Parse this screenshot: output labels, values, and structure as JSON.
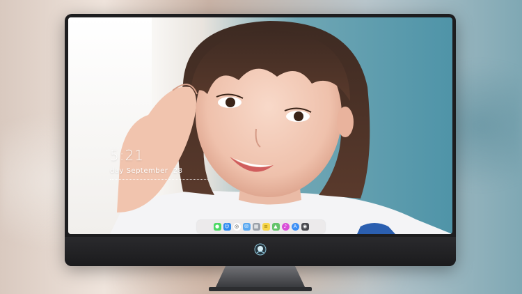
{
  "lockscreen": {
    "time": "5:21",
    "date": "day September  28"
  },
  "dock": {
    "apps": [
      {
        "name": "messages",
        "color": "#4cd964"
      },
      {
        "name": "finder",
        "color": "#2f8bf0"
      },
      {
        "name": "safari",
        "color": "#ffffff"
      },
      {
        "name": "mail",
        "color": "#5aa8f0"
      },
      {
        "name": "launchpad",
        "color": "#9aa0a8"
      },
      {
        "name": "notes",
        "color": "#f7d64b"
      },
      {
        "name": "maps",
        "color": "#64c36a"
      },
      {
        "name": "itunes",
        "color": "#d94fd8"
      },
      {
        "name": "app-store",
        "color": "#3b8ef5"
      },
      {
        "name": "photo-booth",
        "color": "#4a4a4f"
      }
    ]
  }
}
